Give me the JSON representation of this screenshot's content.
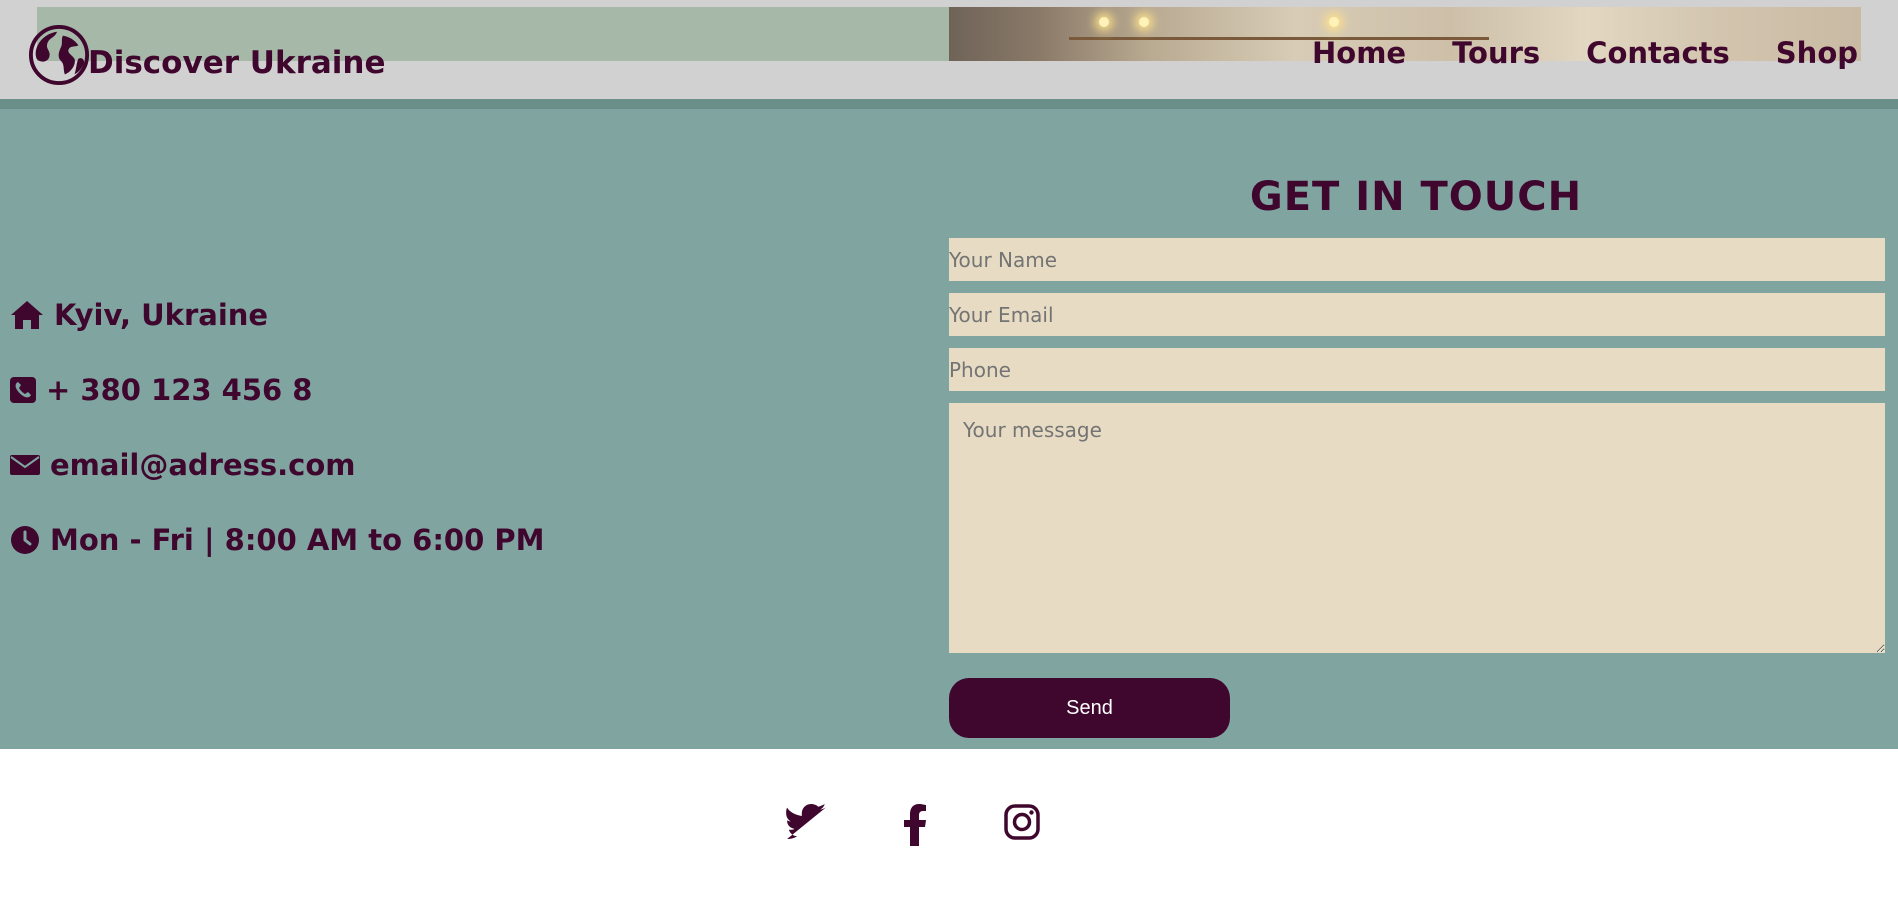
{
  "header": {
    "brand": "Discover Ukraine",
    "nav": [
      "Home",
      "Tours",
      "Contacts",
      "Shop"
    ]
  },
  "contact_info": {
    "location": "Kyiv, Ukraine",
    "phone": "+ 380 123 456 8",
    "email": "email@adress.com",
    "hours": "Mon - Fri | 8:00 AM to 6:00 PM"
  },
  "form": {
    "title": "GET IN TOUCH",
    "name_placeholder": "Your Name",
    "email_placeholder": "Your Email",
    "phone_placeholder": "Phone",
    "message_placeholder": "Your message",
    "send_label": "Send"
  },
  "social": [
    "twitter-icon",
    "facebook-icon",
    "instagram-icon"
  ],
  "colors": {
    "brand": "#3f062e",
    "section_bg": "#80a5a1",
    "field_bg": "#e7dcc3",
    "header_bg": "#d1d1d1"
  }
}
